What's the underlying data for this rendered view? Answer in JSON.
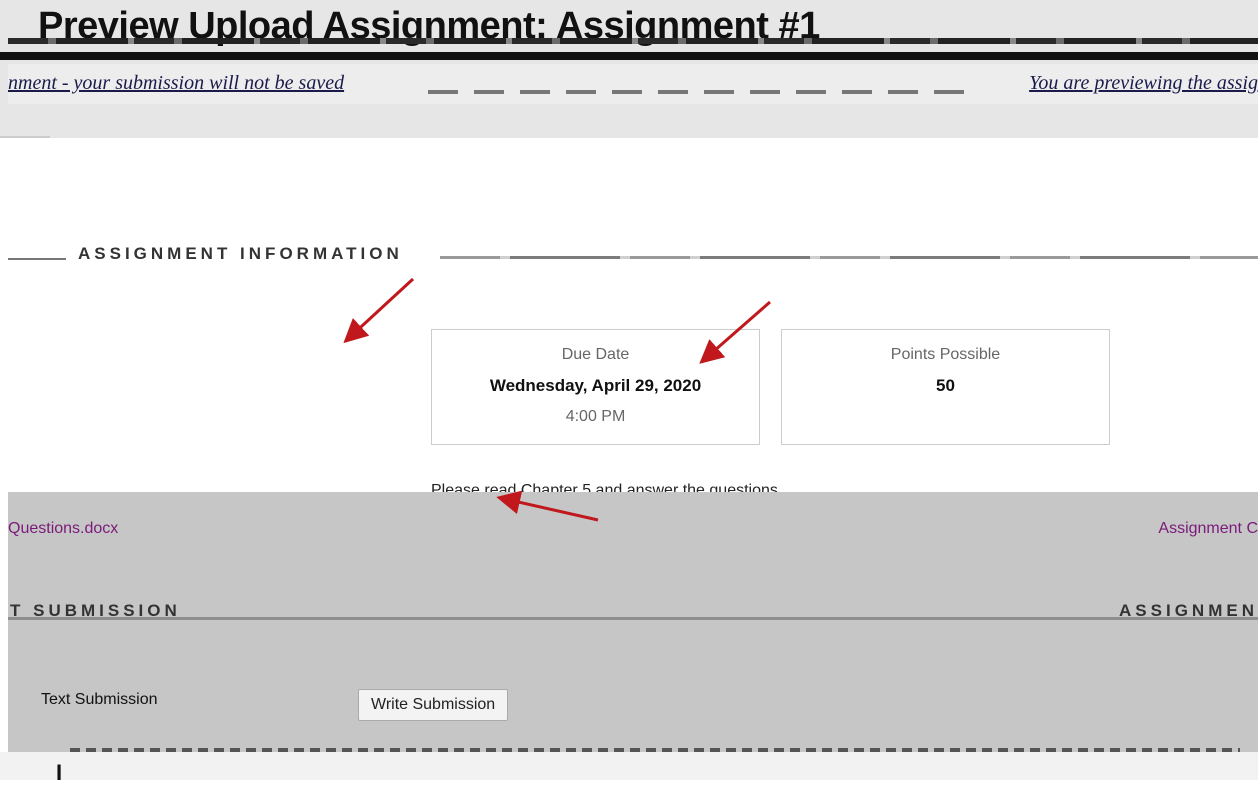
{
  "header": {
    "title": "Preview Upload Assignment: Assignment #1",
    "banner_left": "nment - your submission will not be saved",
    "banner_right": "You are previewing the assig"
  },
  "assignment_info": {
    "section_title": "ASSIGNMENT INFORMATION",
    "due_date": {
      "label": "Due Date",
      "date": "Wednesday, April 29, 2020",
      "time": "4:00 PM"
    },
    "points": {
      "label": "Points Possible",
      "value": "50"
    },
    "instructions": "Please read Chapter 5 and answer the questions."
  },
  "files": {
    "attachment": "Questions.docx",
    "assignment_link": "Assignment C"
  },
  "submission": {
    "section_left": "T SUBMISSION",
    "section_right": "ASSIGNMEN",
    "text_submission_label": "Text Submission",
    "write_button": "Write Submission"
  },
  "colors": {
    "link": "#7a1a7a",
    "arrow": "#c0181c",
    "overlay": "#c6c6c6"
  },
  "icons": {
    "annotation": "arrow-annotation-icon"
  }
}
